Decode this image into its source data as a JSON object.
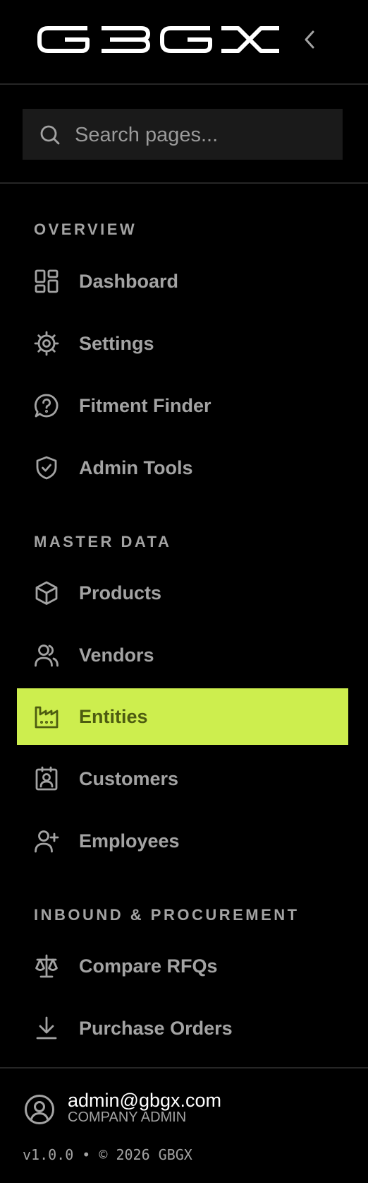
{
  "brand": {
    "logo_text": "GBGX",
    "accent_color": "#cdee4e"
  },
  "header": {
    "collapse_icon": "chevron-left-icon"
  },
  "search": {
    "placeholder": "Search pages...",
    "value": ""
  },
  "sections": [
    {
      "title": "OVERVIEW",
      "items": [
        {
          "label": "Dashboard",
          "icon": "layout-grid-icon",
          "active": false
        },
        {
          "label": "Settings",
          "icon": "gear-icon",
          "active": false
        },
        {
          "label": "Fitment Finder",
          "icon": "help-bubble-icon",
          "active": false
        },
        {
          "label": "Admin Tools",
          "icon": "shield-check-icon",
          "active": false
        }
      ]
    },
    {
      "title": "MASTER DATA",
      "items": [
        {
          "label": "Products",
          "icon": "box-icon",
          "active": false
        },
        {
          "label": "Vendors",
          "icon": "users-icon",
          "active": false
        },
        {
          "label": "Entities",
          "icon": "factory-icon",
          "active": true
        },
        {
          "label": "Customers",
          "icon": "contact-badge-icon",
          "active": false
        },
        {
          "label": "Employees",
          "icon": "user-plus-icon",
          "active": false
        }
      ]
    },
    {
      "title": "INBOUND & PROCUREMENT",
      "items": [
        {
          "label": "Compare RFQs",
          "icon": "scale-icon",
          "active": false
        },
        {
          "label": "Purchase Orders",
          "icon": "download-icon",
          "active": false
        }
      ]
    }
  ],
  "footer": {
    "email": "admin@gbgx.com",
    "role": "COMPANY ADMIN",
    "version": "v1.0.0 • © 2026 GBGX"
  }
}
